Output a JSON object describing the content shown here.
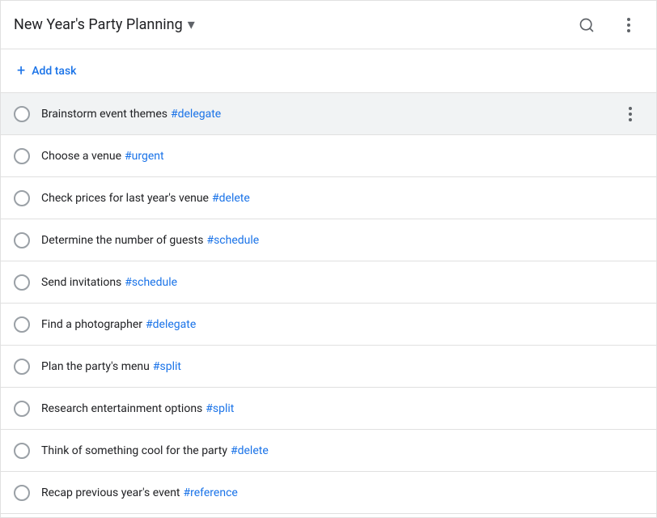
{
  "header": {
    "title": "New Year's Party Planning",
    "dropdown_label": "▾",
    "search_label": "Search",
    "more_label": "More options"
  },
  "add_task": {
    "label": "Add task",
    "plus": "+"
  },
  "tasks": [
    {
      "id": 1,
      "text": "Brainstorm event themes",
      "tag": "#delegate",
      "highlighted": true
    },
    {
      "id": 2,
      "text": "Choose a venue",
      "tag": "#urgent",
      "highlighted": false
    },
    {
      "id": 3,
      "text": "Check prices for last year's venue",
      "tag": "#delete",
      "highlighted": false
    },
    {
      "id": 4,
      "text": "Determine the number of guests",
      "tag": "#schedule",
      "highlighted": false
    },
    {
      "id": 5,
      "text": "Send invitations",
      "tag": "#schedule",
      "highlighted": false
    },
    {
      "id": 6,
      "text": "Find a photographer",
      "tag": "#delegate",
      "highlighted": false
    },
    {
      "id": 7,
      "text": "Plan the party's menu",
      "tag": "#split",
      "highlighted": false
    },
    {
      "id": 8,
      "text": "Research entertainment options",
      "tag": "#split",
      "highlighted": false
    },
    {
      "id": 9,
      "text": "Think of something cool for the party",
      "tag": "#delete",
      "highlighted": false
    },
    {
      "id": 10,
      "text": "Recap previous year's event",
      "tag": "#reference",
      "highlighted": false
    }
  ],
  "icons": {
    "search": "🔍",
    "more_vert": "⋮",
    "chevron_down": "▾",
    "plus": "+"
  }
}
